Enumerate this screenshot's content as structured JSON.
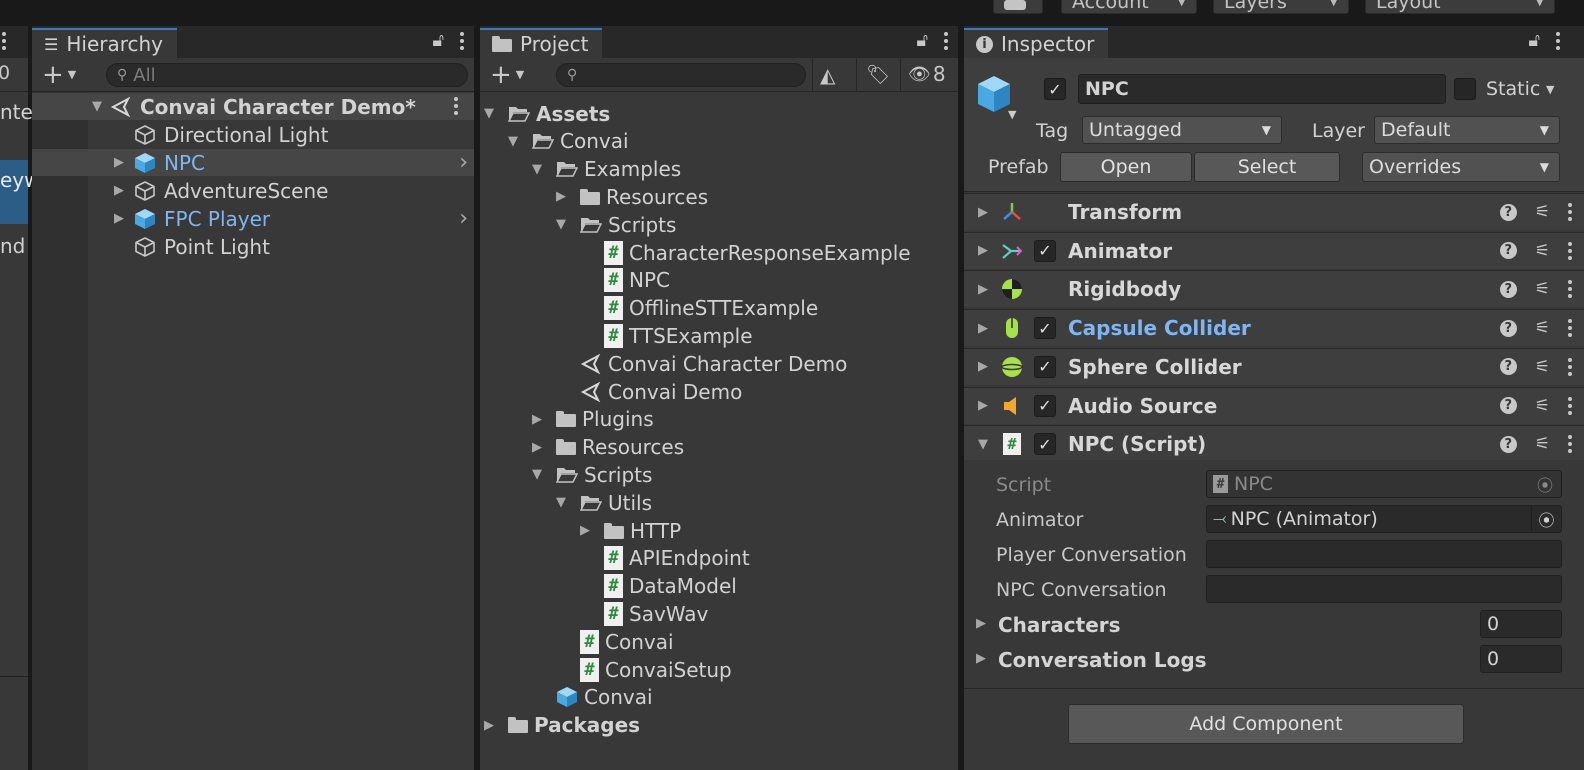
{
  "topbar": {
    "account_label": "Account",
    "layers_label": "Layers",
    "layout_label": "Layout"
  },
  "left_sliver": {
    "count": "0",
    "texts": [
      "nte",
      "eyw",
      "nd"
    ]
  },
  "hierarchy": {
    "tab_label": "Hierarchy",
    "search_placeholder": "All",
    "scene_name": "Convai Character Demo*",
    "items": [
      {
        "label": "Directional Light",
        "expandable": false,
        "blue": false
      },
      {
        "label": "NPC",
        "expandable": true,
        "blue": true
      },
      {
        "label": "AdventureScene",
        "expandable": true,
        "blue": false
      },
      {
        "label": "FPC Player",
        "expandable": true,
        "blue": true
      },
      {
        "label": "Point Light",
        "expandable": false,
        "blue": false
      }
    ]
  },
  "project": {
    "tab_label": "Project",
    "hidden_count": "8",
    "tree": [
      {
        "label": "Assets",
        "type": "folder-open",
        "depth": 0,
        "arrow": "down",
        "bold": true
      },
      {
        "label": "Convai",
        "type": "folder-open",
        "depth": 1,
        "arrow": "down"
      },
      {
        "label": "Examples",
        "type": "folder-open",
        "depth": 2,
        "arrow": "down"
      },
      {
        "label": "Resources",
        "type": "folder",
        "depth": 3,
        "arrow": "right"
      },
      {
        "label": "Scripts",
        "type": "folder-open",
        "depth": 3,
        "arrow": "down"
      },
      {
        "label": "CharacterResponseExample",
        "type": "script",
        "depth": 4
      },
      {
        "label": "NPC",
        "type": "script",
        "depth": 4
      },
      {
        "label": "OfflineSTTExample",
        "type": "script",
        "depth": 4
      },
      {
        "label": "TTSExample",
        "type": "script",
        "depth": 4
      },
      {
        "label": "Convai Character Demo",
        "type": "scene",
        "depth": 3
      },
      {
        "label": "Convai Demo",
        "type": "scene",
        "depth": 3
      },
      {
        "label": "Plugins",
        "type": "folder",
        "depth": 2,
        "arrow": "right"
      },
      {
        "label": "Resources",
        "type": "folder",
        "depth": 2,
        "arrow": "right"
      },
      {
        "label": "Scripts",
        "type": "folder-open",
        "depth": 2,
        "arrow": "down"
      },
      {
        "label": "Utils",
        "type": "folder-open",
        "depth": 3,
        "arrow": "down"
      },
      {
        "label": "HTTP",
        "type": "folder",
        "depth": 4,
        "arrow": "right"
      },
      {
        "label": "APIEndpoint",
        "type": "script",
        "depth": 4
      },
      {
        "label": "DataModel",
        "type": "script",
        "depth": 4
      },
      {
        "label": "SavWav",
        "type": "script",
        "depth": 4
      },
      {
        "label": "Convai",
        "type": "script",
        "depth": 3
      },
      {
        "label": "ConvaiSetup",
        "type": "script",
        "depth": 3
      },
      {
        "label": "Convai",
        "type": "prefab",
        "depth": 2
      },
      {
        "label": "Packages",
        "type": "folder",
        "depth": 0,
        "arrow": "right",
        "bold": true
      }
    ]
  },
  "inspector": {
    "tab_label": "Inspector",
    "object_name": "NPC",
    "static_label": "Static",
    "tag_label": "Tag",
    "tag_value": "Untagged",
    "layer_label": "Layer",
    "layer_value": "Default",
    "prefab_label": "Prefab",
    "open_label": "Open",
    "select_label": "Select",
    "overrides_label": "Overrides",
    "components": [
      {
        "name": "Transform",
        "icon": "transform-icon",
        "checkbox": false,
        "blue": false,
        "expanded": false
      },
      {
        "name": "Animator",
        "icon": "animator-icon",
        "checkbox": true,
        "blue": false,
        "expanded": false
      },
      {
        "name": "Rigidbody",
        "icon": "rigidbody-icon",
        "checkbox": false,
        "blue": false,
        "expanded": false
      },
      {
        "name": "Capsule Collider",
        "icon": "capsule-collider-icon",
        "checkbox": true,
        "blue": true,
        "expanded": false
      },
      {
        "name": "Sphere Collider",
        "icon": "sphere-collider-icon",
        "checkbox": true,
        "blue": false,
        "expanded": false
      },
      {
        "name": "Audio Source",
        "icon": "audio-source-icon",
        "checkbox": true,
        "blue": false,
        "expanded": false
      },
      {
        "name": "NPC (Script)",
        "icon": "script-icon",
        "checkbox": true,
        "blue": false,
        "expanded": true
      }
    ],
    "script_fields": {
      "script_label": "Script",
      "script_value": "NPC",
      "animator_label": "Animator",
      "animator_value": "NPC (Animator)",
      "player_conv_label": "Player Conversation",
      "player_conv_value": "",
      "npc_conv_label": "NPC Conversation",
      "npc_conv_value": "",
      "characters_label": "Characters",
      "characters_value": "0",
      "logs_label": "Conversation Logs",
      "logs_value": "0"
    },
    "add_component_label": "Add Component"
  },
  "colors": {
    "accent": "#3a79bb",
    "prefab_blue": "#7fb6f2",
    "panel_bg": "#383838"
  }
}
